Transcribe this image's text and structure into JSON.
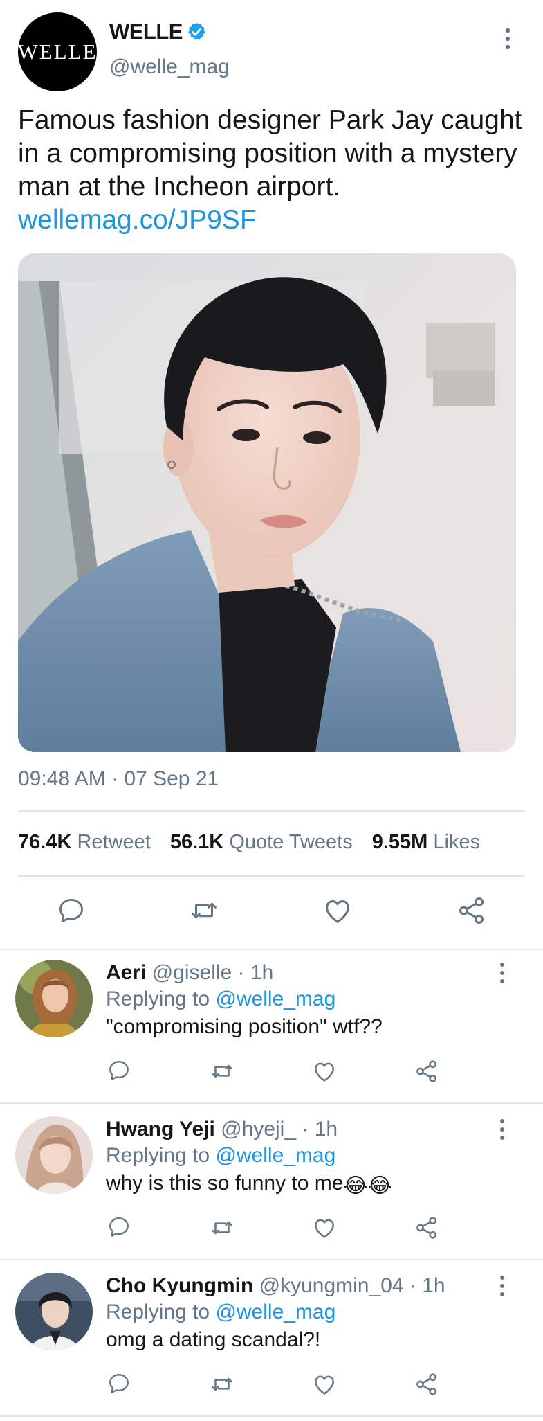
{
  "tweet": {
    "author": {
      "logo_text": "WELLE",
      "display_name": "WELLE",
      "handle": "@welle_mag",
      "verified": true,
      "verified_icon": "verified-badge-icon"
    },
    "text": "Famous fashion designer Park Jay caught in a compromising position with a mystery man at the Incheon airport.",
    "link": "wellemag.co/JP9SF",
    "timestamp": "09:48 AM · 07 Sep 21",
    "stats": {
      "retweets_count": "76.4K",
      "retweets_label": "Retweet",
      "quotes_count": "56.1K",
      "quotes_label": "Quote Tweets",
      "likes_count": "9.55M",
      "likes_label": "Likes"
    },
    "action_icons": [
      "reply-icon",
      "retweet-icon",
      "like-icon",
      "share-icon"
    ]
  },
  "colors": {
    "link": "#1b95e0",
    "muted": "#657786",
    "divider": "#e1e8ed",
    "verified": "#1da1f2"
  },
  "replies": [
    {
      "display_name": "Aeri",
      "handle": "@giselle",
      "time": "· 1h",
      "replying_prefix": "Replying to",
      "replying_handle": "@welle_mag",
      "text": "\"compromising position\" wtf??"
    },
    {
      "display_name": "Hwang Yeji",
      "handle": "@hyeji_",
      "time": "· 1h",
      "replying_prefix": "Replying to",
      "replying_handle": "@welle_mag",
      "text": "why is this so funny to me",
      "emoji": "😂😂"
    },
    {
      "display_name": "Cho Kyungmin",
      "handle": "@kyungmin_04",
      "time": "· 1h",
      "replying_prefix": "Replying to",
      "replying_handle": "@welle_mag",
      "text": "omg a dating scandal?!"
    }
  ]
}
